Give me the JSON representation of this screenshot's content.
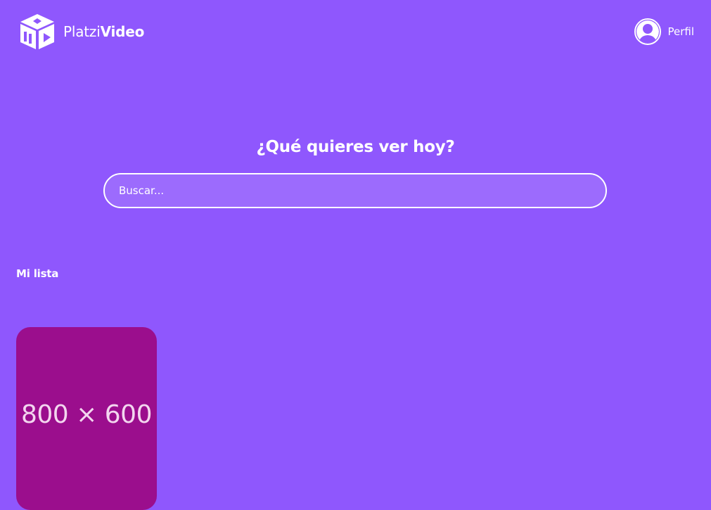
{
  "header": {
    "logo_text_light": "Platzi",
    "logo_text_bold": "Video",
    "profile_label": "Perfil",
    "logo_icon": "platzi-video-cube-icon",
    "avatar_icon": "user-avatar-icon"
  },
  "main": {
    "title": "¿Qué quieres ver hoy?",
    "search": {
      "placeholder": "Buscar...",
      "value": ""
    }
  },
  "sections": [
    {
      "title": "Mi lista",
      "items": [
        {
          "image_label": "800 × 600"
        }
      ]
    }
  ],
  "colors": {
    "background": "#8f57fd",
    "card_placeholder": "#9b0e8d",
    "text": "#ffffff"
  }
}
